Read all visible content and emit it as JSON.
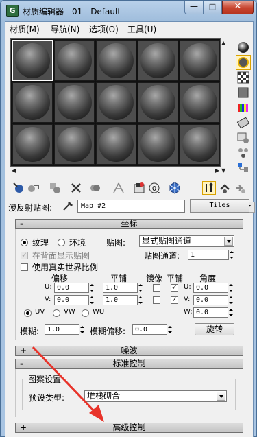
{
  "window": {
    "title": "材质编辑器 - 01 - Default",
    "minimize": "—",
    "maximize": "□",
    "close": "✕"
  },
  "menu": [
    "材质(M)",
    "导航(N)",
    "选项(O)",
    "工具(U)"
  ],
  "slots": {
    "rows": 3,
    "cols": 5,
    "selected_index": 0
  },
  "right_toolbar": [
    "sample-type-sphere-icon",
    "backlight-icon",
    "background-checker-icon",
    "sample-uv-tiling-icon",
    "video-color-check-icon",
    "make-preview-icon",
    "options-icon",
    "select-by-material-icon",
    "material-navigator-icon"
  ],
  "bottom_toolbar": [
    "get-material-icon",
    "put-to-scene-icon",
    "assign-to-selection-icon",
    "reset-map-icon",
    "make-copy-icon",
    "make-unique-icon",
    "put-to-library-icon",
    "material-id-channel-icon",
    "show-in-viewport-icon",
    "show-end-result-icon",
    "go-to-parent-icon",
    "go-forward-to-sibling-icon"
  ],
  "material_id_value": "0",
  "map_row": {
    "label": "漫反射贴图:",
    "map_name": "Map #2",
    "map_type": "Tiles"
  },
  "coordinates": {
    "header": "坐标",
    "sign": "-",
    "texture_label": "纹理",
    "environ_label": "环境",
    "mapping_label": "贴图:",
    "mapping_value": "显式贴图通道",
    "show_back_label": "在背面显示贴图",
    "map_channel_label": "贴图通道:",
    "map_channel_value": "1",
    "real_world_label": "使用真实世界比例",
    "col_offset": "偏移",
    "col_tiling": "平铺",
    "col_mirror": "镜像",
    "col_tile": "平铺",
    "col_angle": "角度",
    "u_label": "U:",
    "v_label": "V:",
    "w_label": "W:",
    "u_offset": "0.0",
    "v_offset": "0.0",
    "u_tiling": "1.0",
    "v_tiling": "1.0",
    "u_angle": "0.0",
    "v_angle": "0.0",
    "w_angle": "0.0",
    "u_mirror": false,
    "v_mirror": false,
    "u_tile": true,
    "v_tile": true,
    "uv_label": "UV",
    "vw_label": "VW",
    "wu_label": "WU",
    "blur_label": "模糊:",
    "blur_value": "1.0",
    "blur_offset_label": "模糊偏移:",
    "blur_offset_value": "0.0",
    "rotate_button": "旋转"
  },
  "noise": {
    "header": "噪波",
    "sign": "+"
  },
  "standard_controls": {
    "header": "标准控制",
    "sign": "-",
    "group_label": "图案设置",
    "preset_label": "预设类型:",
    "preset_value": "堆栈砌合"
  },
  "advanced_controls": {
    "header": "高级控制",
    "sign": "+"
  },
  "colors": {
    "annotation_arrow": "#e8332a",
    "slot_bg": "#111111"
  }
}
